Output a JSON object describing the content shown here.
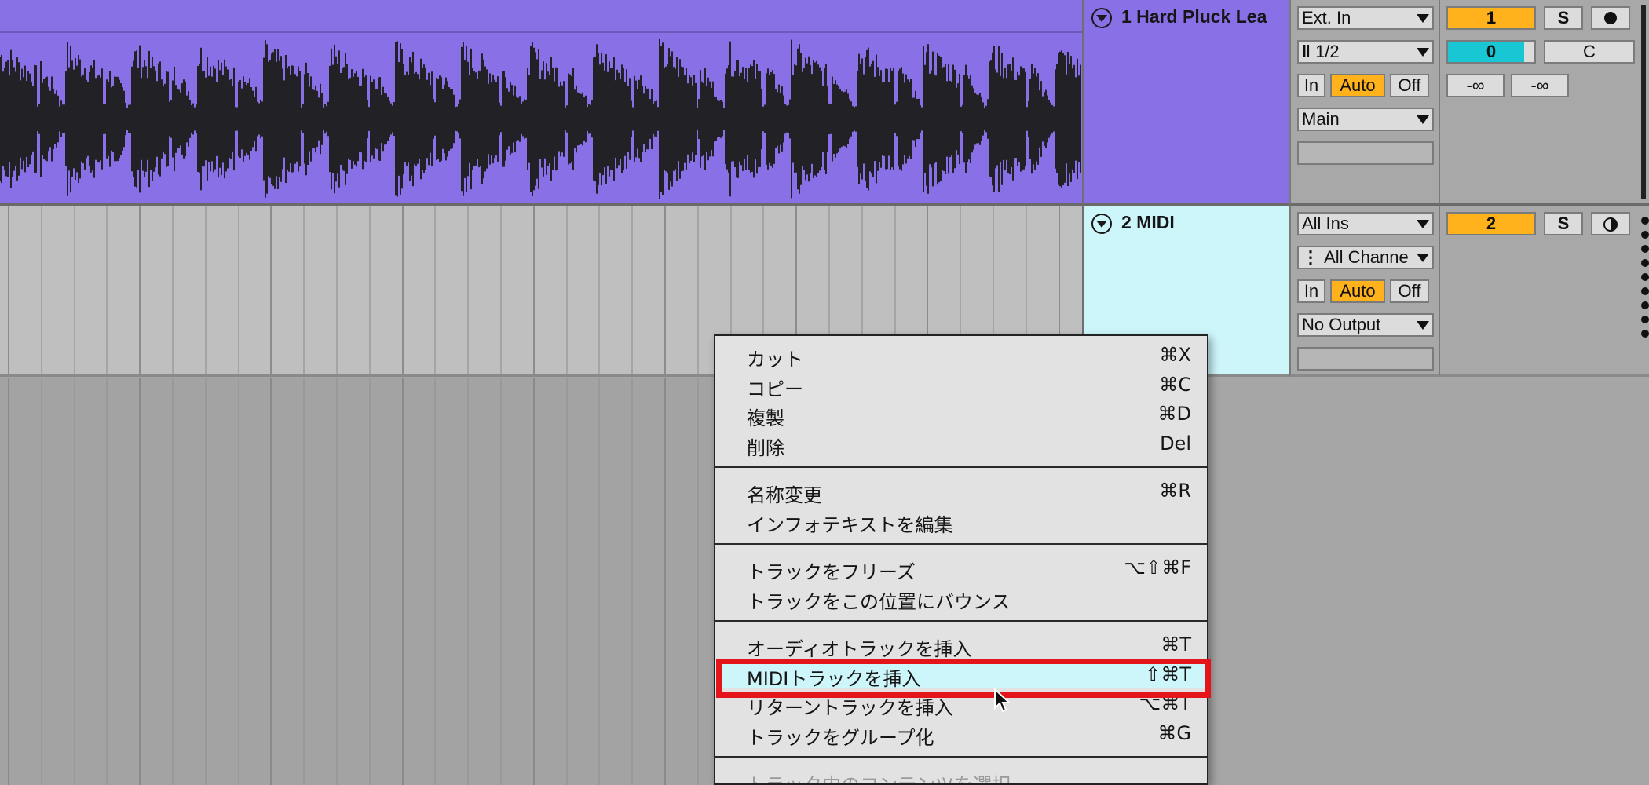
{
  "tracks": [
    {
      "name": "1 Hard Pluck Lea",
      "color": "#8a70e6",
      "input_type": "Ext. In",
      "input_channel": "1/2",
      "monitor": [
        "In",
        "Auto",
        "Off"
      ],
      "monitor_active": "Auto",
      "output": "Main",
      "number": "1",
      "solo": "S",
      "volume": "0",
      "pan": "C",
      "send_a": "-∞",
      "send_b": "-∞"
    },
    {
      "name": "2 MIDI",
      "color": "#cdf6fb",
      "input_type": "All Ins",
      "input_channel": "All Channe",
      "monitor": [
        "In",
        "Auto",
        "Off"
      ],
      "monitor_active": "Auto",
      "output": "No Output",
      "number": "2",
      "solo": "S"
    }
  ],
  "context_menu": {
    "groups": [
      [
        {
          "label": "カット",
          "shortcut": "⌘X"
        },
        {
          "label": "コピー",
          "shortcut": "⌘C"
        },
        {
          "label": "複製",
          "shortcut": "⌘D"
        },
        {
          "label": "削除",
          "shortcut": "Del"
        }
      ],
      [
        {
          "label": "名称変更",
          "shortcut": "⌘R"
        },
        {
          "label": "インフォテキストを編集",
          "shortcut": ""
        }
      ],
      [
        {
          "label": "トラックをフリーズ",
          "shortcut": "⌥⇧⌘F"
        },
        {
          "label": "トラックをこの位置にバウンス",
          "shortcut": ""
        }
      ],
      [
        {
          "label": "オーディオトラックを挿入",
          "shortcut": "⌘T"
        },
        {
          "label": "MIDIトラックを挿入",
          "shortcut": "⇧⌘T"
        },
        {
          "label": "リターントラックを挿入",
          "shortcut": "⌥⌘T"
        },
        {
          "label": "トラックをグループ化",
          "shortcut": "⌘G"
        }
      ],
      [
        {
          "label": "トラック内のコンテンツを選択",
          "shortcut": ""
        }
      ]
    ],
    "highlighted": "MIDIトラックを挿入"
  },
  "colors": {
    "accent_orange": "#ffb21c",
    "volume_cyan": "#18c6d4",
    "highlight_red": "#e3151a"
  }
}
